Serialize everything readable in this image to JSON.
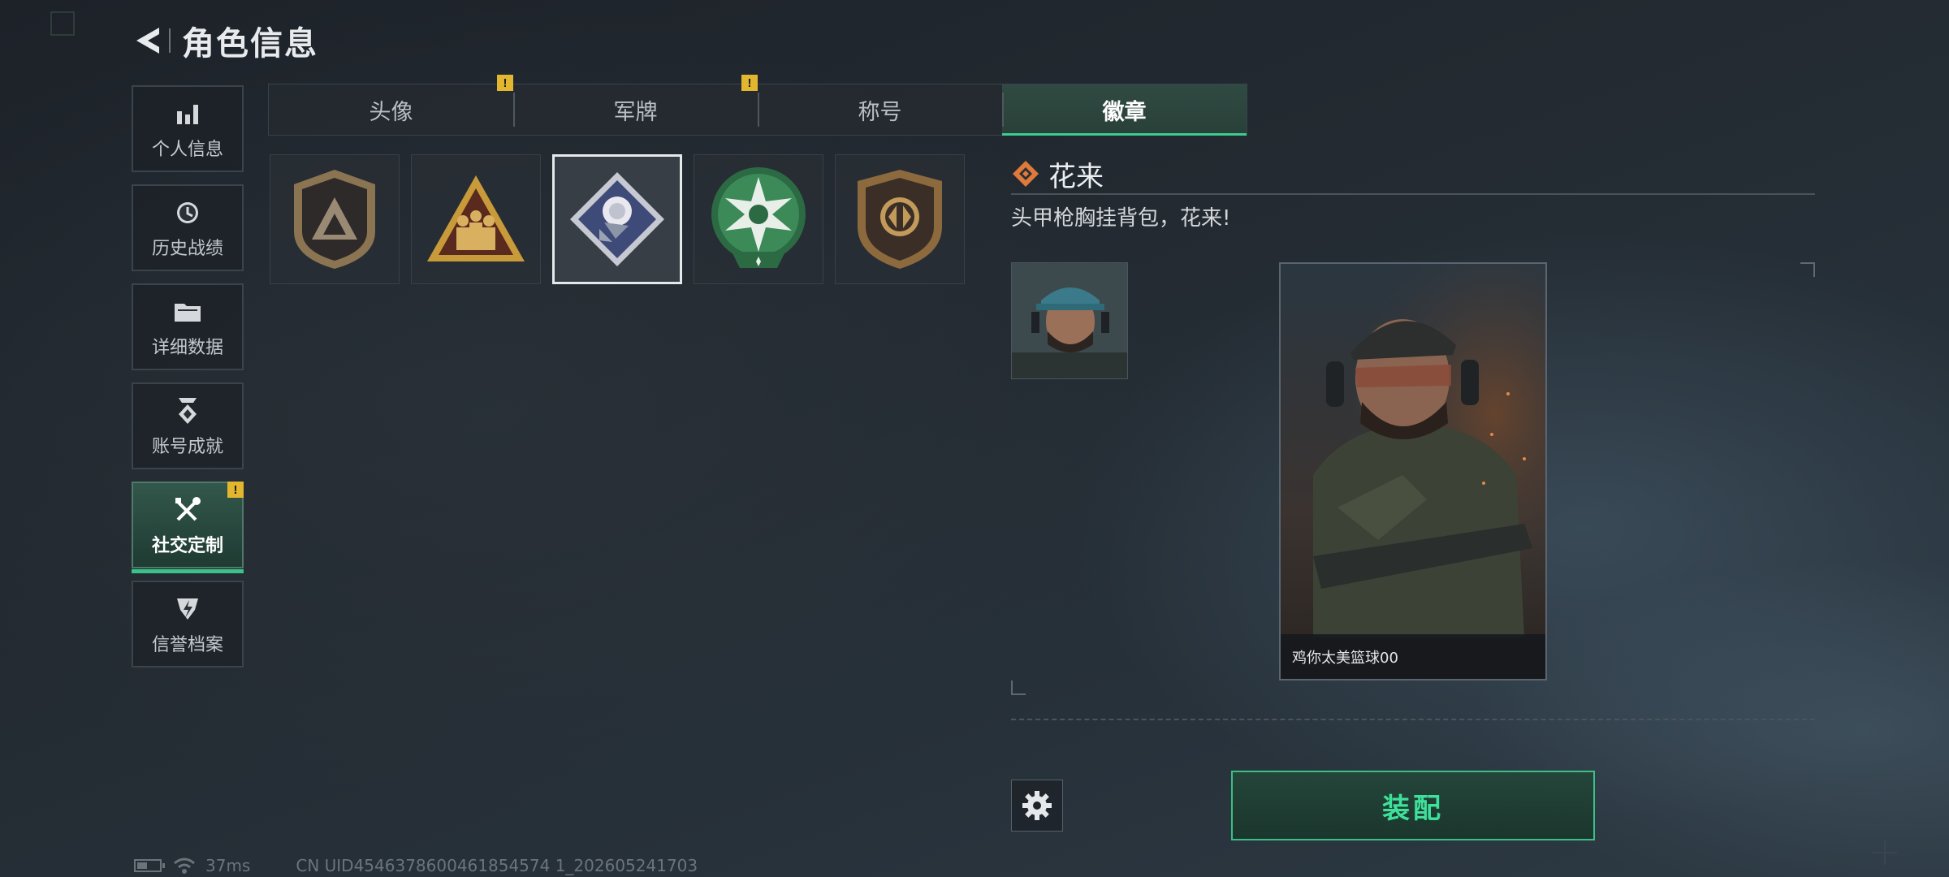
{
  "header": {
    "title": "角色信息"
  },
  "sidebar": {
    "items": [
      {
        "label": "个人信息",
        "icon": "bar-chart-icon"
      },
      {
        "label": "历史战绩",
        "icon": "clock-icon"
      },
      {
        "label": "详细数据",
        "icon": "folder-icon"
      },
      {
        "label": "账号成就",
        "icon": "achievement-icon"
      },
      {
        "label": "社交定制",
        "icon": "tools-icon",
        "active": true,
        "badge": "!"
      },
      {
        "label": "信誉档案",
        "icon": "shield-icon"
      }
    ]
  },
  "tabs": [
    {
      "label": "头像",
      "badge": ""
    },
    {
      "label": "军牌",
      "badge": "!"
    },
    {
      "label": "称号",
      "badge": "!"
    },
    {
      "label": "徽章",
      "active": true
    }
  ],
  "badges": [
    {
      "name": "dark-triangle-badge"
    },
    {
      "name": "gold-soldiers-badge"
    },
    {
      "name": "rose-diamond-badge",
      "selected": true
    },
    {
      "name": "green-star-badge"
    },
    {
      "name": "bronze-shield-badge"
    }
  ],
  "detail": {
    "name": "花来",
    "description": "头甲枪胸挂背包，花来!",
    "card_name": "鸡你太美篮球00"
  },
  "actions": {
    "equip_label": "装配"
  },
  "footer": {
    "ping": "37ms",
    "uid": "CN UID4546378600461854574 1_202605241703"
  },
  "colors": {
    "accent": "#3dcb90",
    "warning": "#e3b62f",
    "active_bg": "#2f4a42"
  }
}
